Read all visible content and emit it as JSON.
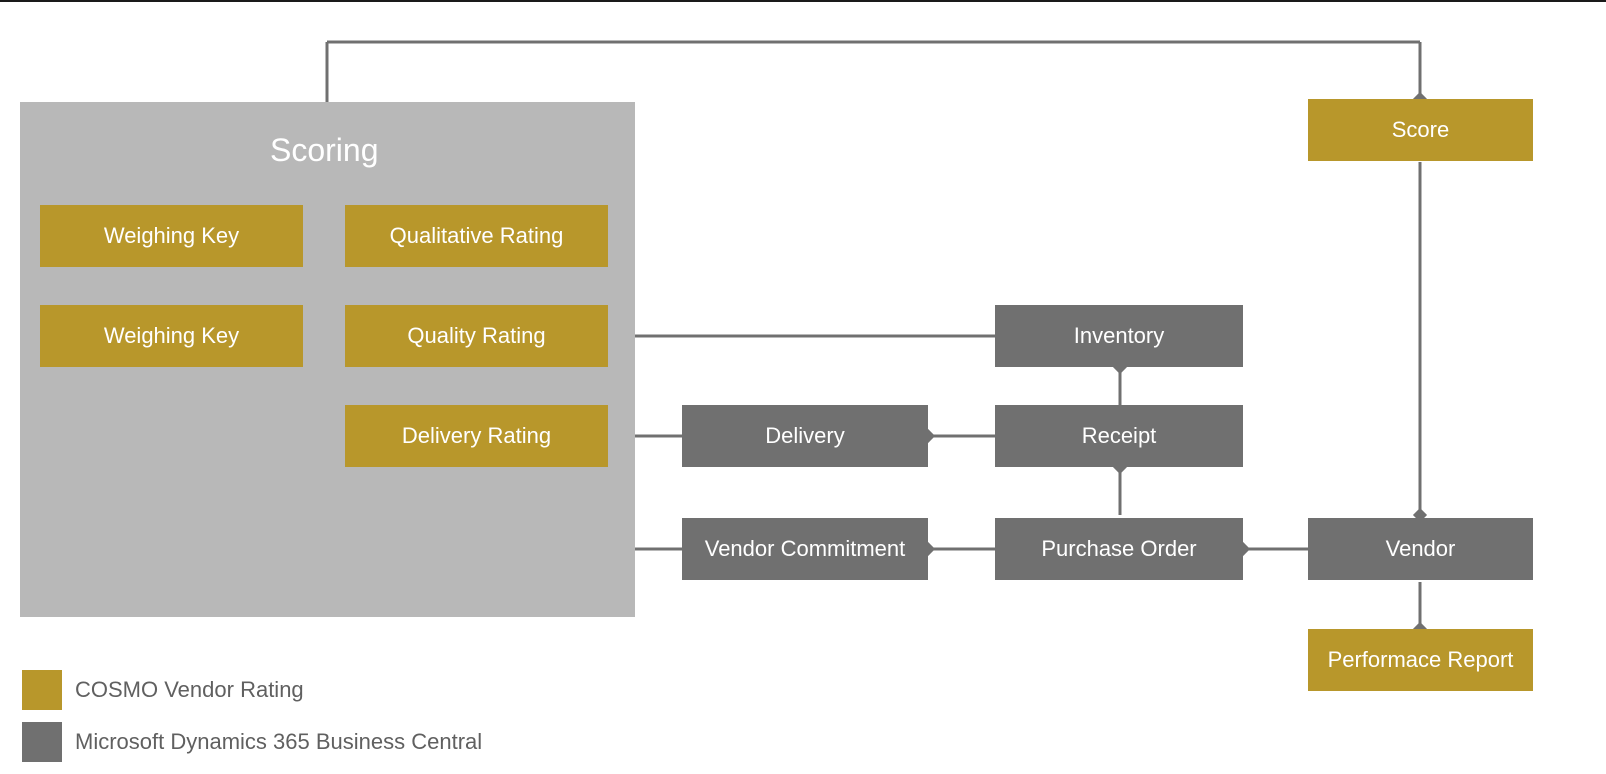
{
  "scoring": {
    "title": "Scoring",
    "weighing_key_1": "Weighing Key",
    "qualitative_rating": "Qualitative Rating",
    "weighing_key_2": "Weighing Key",
    "quality_rating": "Quality Rating",
    "delivery_rating": "Delivery Rating"
  },
  "flow": {
    "score": "Score",
    "inventory": "Inventory",
    "delivery": "Delivery",
    "receipt": "Receipt",
    "vendor_commitment": "Vendor Commitment",
    "purchase_order": "Purchase Order",
    "vendor": "Vendor",
    "performance_report": "Performace Report"
  },
  "legend": {
    "cosmo": "COSMO Vendor Rating",
    "ms": "Microsoft Dynamics 365 Business Central"
  },
  "colors": {
    "gold": "#b8972b",
    "gray": "#707070",
    "scoring_bg": "#b8b8b8"
  }
}
